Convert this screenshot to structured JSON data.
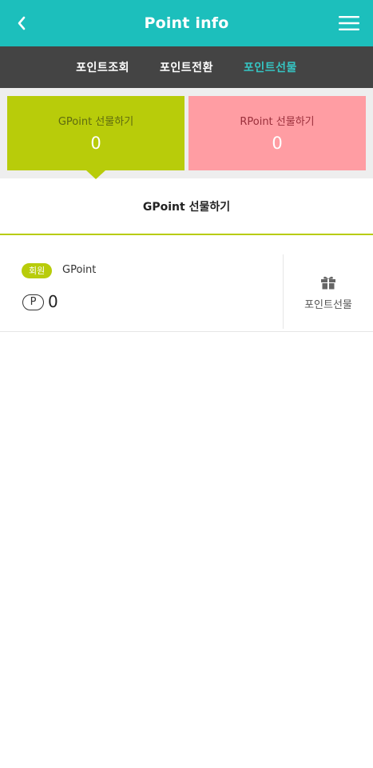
{
  "header": {
    "title": "Point info",
    "back_icon": "chevron-left-icon",
    "menu_icon": "hamburger-menu-icon"
  },
  "tabs": [
    {
      "label": "포인트조회",
      "active": false
    },
    {
      "label": "포인트전환",
      "active": false
    },
    {
      "label": "포인트선물",
      "active": true
    }
  ],
  "cards": {
    "gpoint": {
      "label": "GPoint 선물하기",
      "value": "0",
      "color": "#b8cc0a",
      "selected": true
    },
    "rpoint": {
      "label": "RPoint 선물하기",
      "value": "0",
      "color": "#ff9da3",
      "selected": false
    }
  },
  "section": {
    "title": "GPoint 선물하기"
  },
  "point_row": {
    "badge": "회원",
    "name": "GPoint",
    "unit_symbol": "P",
    "value": "0",
    "gift_icon": "gift-icon",
    "gift_label": "포인트선물"
  },
  "colors": {
    "header": "#1cbfbc",
    "tab_bar": "#444444",
    "tab_active": "#35c6c4",
    "accent_green": "#b8cc0a",
    "accent_pink": "#ff9da3"
  }
}
